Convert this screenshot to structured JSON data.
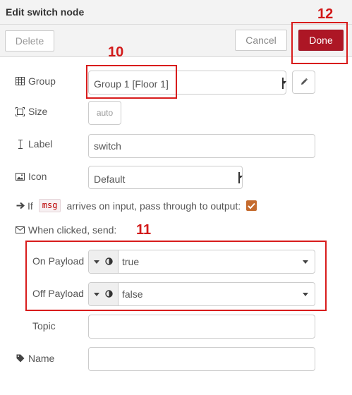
{
  "dialog": {
    "title": "Edit switch node"
  },
  "toolbar": {
    "delete_label": "Delete",
    "cancel_label": "Cancel",
    "done_label": "Done"
  },
  "annotations": {
    "done": "12",
    "group": "10",
    "payload": "11"
  },
  "colors": {
    "done_bg": "#ad1625",
    "annotation": "#d21919",
    "checkbox": "#c56b2e"
  },
  "form": {
    "group": {
      "label": "Group",
      "value": "Group 1 [Floor 1]"
    },
    "size": {
      "label": "Size",
      "value": "auto"
    },
    "label": {
      "label": "Label",
      "value": "switch"
    },
    "icon": {
      "label": "Icon",
      "value": "Default"
    },
    "passthrough": {
      "prefix": "If",
      "code": "msg",
      "suffix": "arrives on input, pass through to output:",
      "checked": true
    },
    "when_clicked": {
      "label": "When clicked, send:"
    },
    "on_payload": {
      "label": "On Payload",
      "value": "true"
    },
    "off_payload": {
      "label": "Off Payload",
      "value": "false"
    },
    "topic": {
      "label": "Topic",
      "value": ""
    },
    "name": {
      "label": "Name",
      "value": ""
    }
  }
}
